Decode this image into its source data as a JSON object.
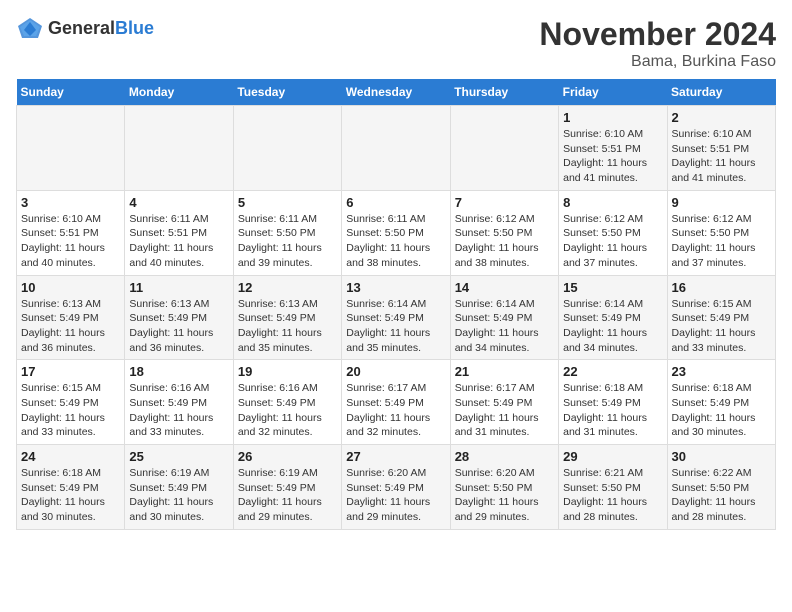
{
  "logo": {
    "general": "General",
    "blue": "Blue"
  },
  "title": "November 2024",
  "subtitle": "Bama, Burkina Faso",
  "days_of_week": [
    "Sunday",
    "Monday",
    "Tuesday",
    "Wednesday",
    "Thursday",
    "Friday",
    "Saturday"
  ],
  "weeks": [
    [
      {
        "day": "",
        "info": ""
      },
      {
        "day": "",
        "info": ""
      },
      {
        "day": "",
        "info": ""
      },
      {
        "day": "",
        "info": ""
      },
      {
        "day": "",
        "info": ""
      },
      {
        "day": "1",
        "info": "Sunrise: 6:10 AM\nSunset: 5:51 PM\nDaylight: 11 hours and 41 minutes."
      },
      {
        "day": "2",
        "info": "Sunrise: 6:10 AM\nSunset: 5:51 PM\nDaylight: 11 hours and 41 minutes."
      }
    ],
    [
      {
        "day": "3",
        "info": "Sunrise: 6:10 AM\nSunset: 5:51 PM\nDaylight: 11 hours and 40 minutes."
      },
      {
        "day": "4",
        "info": "Sunrise: 6:11 AM\nSunset: 5:51 PM\nDaylight: 11 hours and 40 minutes."
      },
      {
        "day": "5",
        "info": "Sunrise: 6:11 AM\nSunset: 5:50 PM\nDaylight: 11 hours and 39 minutes."
      },
      {
        "day": "6",
        "info": "Sunrise: 6:11 AM\nSunset: 5:50 PM\nDaylight: 11 hours and 38 minutes."
      },
      {
        "day": "7",
        "info": "Sunrise: 6:12 AM\nSunset: 5:50 PM\nDaylight: 11 hours and 38 minutes."
      },
      {
        "day": "8",
        "info": "Sunrise: 6:12 AM\nSunset: 5:50 PM\nDaylight: 11 hours and 37 minutes."
      },
      {
        "day": "9",
        "info": "Sunrise: 6:12 AM\nSunset: 5:50 PM\nDaylight: 11 hours and 37 minutes."
      }
    ],
    [
      {
        "day": "10",
        "info": "Sunrise: 6:13 AM\nSunset: 5:49 PM\nDaylight: 11 hours and 36 minutes."
      },
      {
        "day": "11",
        "info": "Sunrise: 6:13 AM\nSunset: 5:49 PM\nDaylight: 11 hours and 36 minutes."
      },
      {
        "day": "12",
        "info": "Sunrise: 6:13 AM\nSunset: 5:49 PM\nDaylight: 11 hours and 35 minutes."
      },
      {
        "day": "13",
        "info": "Sunrise: 6:14 AM\nSunset: 5:49 PM\nDaylight: 11 hours and 35 minutes."
      },
      {
        "day": "14",
        "info": "Sunrise: 6:14 AM\nSunset: 5:49 PM\nDaylight: 11 hours and 34 minutes."
      },
      {
        "day": "15",
        "info": "Sunrise: 6:14 AM\nSunset: 5:49 PM\nDaylight: 11 hours and 34 minutes."
      },
      {
        "day": "16",
        "info": "Sunrise: 6:15 AM\nSunset: 5:49 PM\nDaylight: 11 hours and 33 minutes."
      }
    ],
    [
      {
        "day": "17",
        "info": "Sunrise: 6:15 AM\nSunset: 5:49 PM\nDaylight: 11 hours and 33 minutes."
      },
      {
        "day": "18",
        "info": "Sunrise: 6:16 AM\nSunset: 5:49 PM\nDaylight: 11 hours and 33 minutes."
      },
      {
        "day": "19",
        "info": "Sunrise: 6:16 AM\nSunset: 5:49 PM\nDaylight: 11 hours and 32 minutes."
      },
      {
        "day": "20",
        "info": "Sunrise: 6:17 AM\nSunset: 5:49 PM\nDaylight: 11 hours and 32 minutes."
      },
      {
        "day": "21",
        "info": "Sunrise: 6:17 AM\nSunset: 5:49 PM\nDaylight: 11 hours and 31 minutes."
      },
      {
        "day": "22",
        "info": "Sunrise: 6:18 AM\nSunset: 5:49 PM\nDaylight: 11 hours and 31 minutes."
      },
      {
        "day": "23",
        "info": "Sunrise: 6:18 AM\nSunset: 5:49 PM\nDaylight: 11 hours and 30 minutes."
      }
    ],
    [
      {
        "day": "24",
        "info": "Sunrise: 6:18 AM\nSunset: 5:49 PM\nDaylight: 11 hours and 30 minutes."
      },
      {
        "day": "25",
        "info": "Sunrise: 6:19 AM\nSunset: 5:49 PM\nDaylight: 11 hours and 30 minutes."
      },
      {
        "day": "26",
        "info": "Sunrise: 6:19 AM\nSunset: 5:49 PM\nDaylight: 11 hours and 29 minutes."
      },
      {
        "day": "27",
        "info": "Sunrise: 6:20 AM\nSunset: 5:49 PM\nDaylight: 11 hours and 29 minutes."
      },
      {
        "day": "28",
        "info": "Sunrise: 6:20 AM\nSunset: 5:50 PM\nDaylight: 11 hours and 29 minutes."
      },
      {
        "day": "29",
        "info": "Sunrise: 6:21 AM\nSunset: 5:50 PM\nDaylight: 11 hours and 28 minutes."
      },
      {
        "day": "30",
        "info": "Sunrise: 6:22 AM\nSunset: 5:50 PM\nDaylight: 11 hours and 28 minutes."
      }
    ]
  ]
}
